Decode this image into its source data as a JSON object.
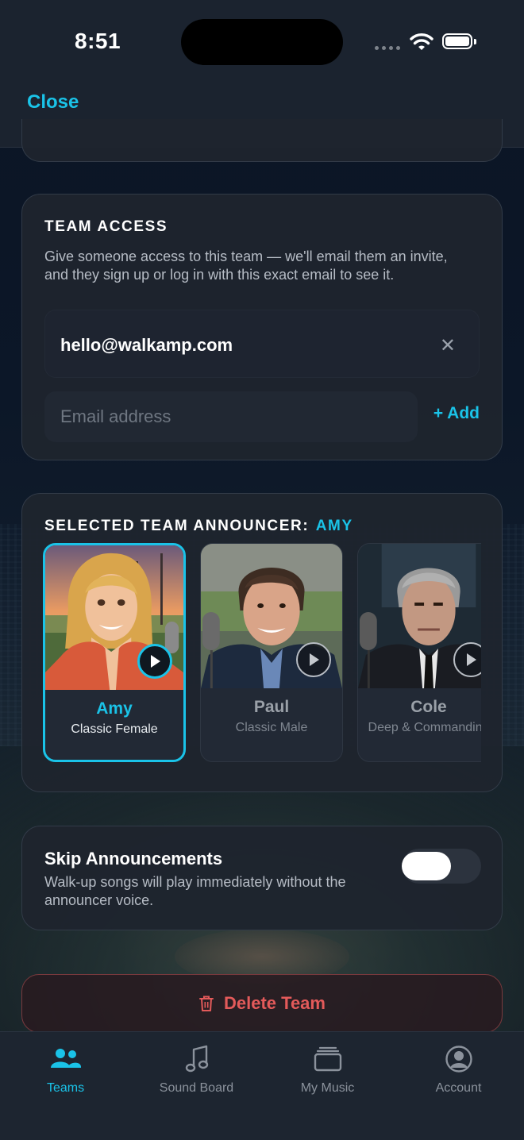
{
  "status_bar": {
    "time": "8:51"
  },
  "header": {
    "close_label": "Close"
  },
  "team_access": {
    "title": "TEAM ACCESS",
    "description": "Give someone access to this team — we'll email them an invite, and they sign up or log in with this exact email to see it.",
    "emails": [
      "hello@walkamp.com"
    ],
    "email_placeholder": "Email address",
    "add_label": "+ Add"
  },
  "announcer": {
    "title_prefix": "SELECTED TEAM ANNOUNCER:",
    "selected_name": "AMY",
    "options": [
      {
        "name": "Amy",
        "description": "Classic Female",
        "selected": true
      },
      {
        "name": "Paul",
        "description": "Classic Male",
        "selected": false
      },
      {
        "name": "Cole",
        "description": "Deep & Commanding",
        "selected": false
      }
    ]
  },
  "skip_announcements": {
    "title": "Skip Announcements",
    "description": "Walk-up songs will play immediately without the announcer voice.",
    "enabled": false
  },
  "delete_team": {
    "label": "Delete Team"
  },
  "tabbar": {
    "tabs": [
      {
        "label": "Teams",
        "icon": "people-icon",
        "active": true
      },
      {
        "label": "Sound Board",
        "icon": "music-note-icon",
        "active": false
      },
      {
        "label": "My Music",
        "icon": "stack-icon",
        "active": false
      },
      {
        "label": "Account",
        "icon": "account-icon",
        "active": false
      }
    ]
  },
  "colors": {
    "accent": "#1ac3e8",
    "danger": "#e35a5a",
    "background": "#0c1728",
    "card": "#1e242e"
  }
}
